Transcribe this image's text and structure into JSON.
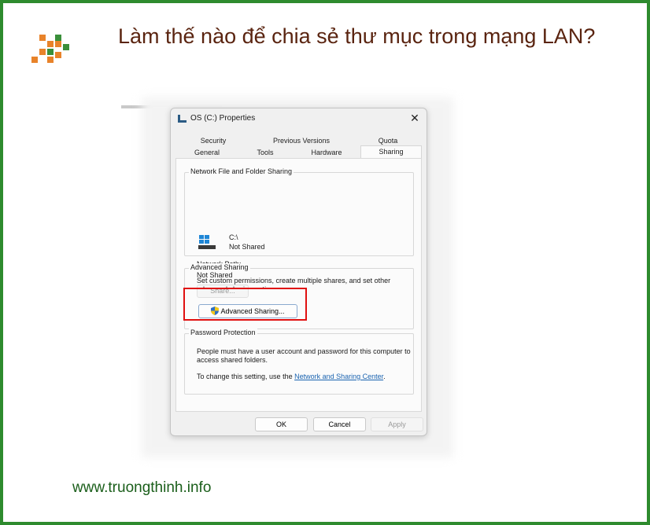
{
  "page": {
    "title": "Làm thế nào để chia sẻ thư mục trong mạng LAN?",
    "footer": "www.truongthinh.info",
    "colors": {
      "border": "#2e8b2e",
      "title": "#5a2410",
      "footer": "#1a5e1a",
      "highlight": "#e01010"
    }
  },
  "dialog": {
    "title": "OS (C:) Properties",
    "close_glyph": "✕",
    "tabs_row1": [
      "Security",
      "Previous Versions",
      "Quota"
    ],
    "tabs_row2": [
      "General",
      "Tools",
      "Hardware",
      "Sharing"
    ],
    "active_tab": "Sharing",
    "network_sharing": {
      "label": "Network File and Folder Sharing",
      "drive": "C:\\",
      "status": "Not Shared",
      "path_label": "Network Path:",
      "path_value": "Not Shared",
      "share_button": "Share..."
    },
    "advanced_sharing": {
      "label": "Advanced Sharing",
      "description": "Set custom permissions, create multiple shares, and set other advanced sharing options.",
      "button": "Advanced Sharing..."
    },
    "password_protection": {
      "label": "Password Protection",
      "description": "People must have a user account and password for this computer to access shared folders.",
      "change_prefix": "To change this setting, use the ",
      "change_link": "Network and Sharing Center",
      "change_suffix": "."
    },
    "buttons": {
      "ok": "OK",
      "cancel": "Cancel",
      "apply": "Apply"
    }
  }
}
